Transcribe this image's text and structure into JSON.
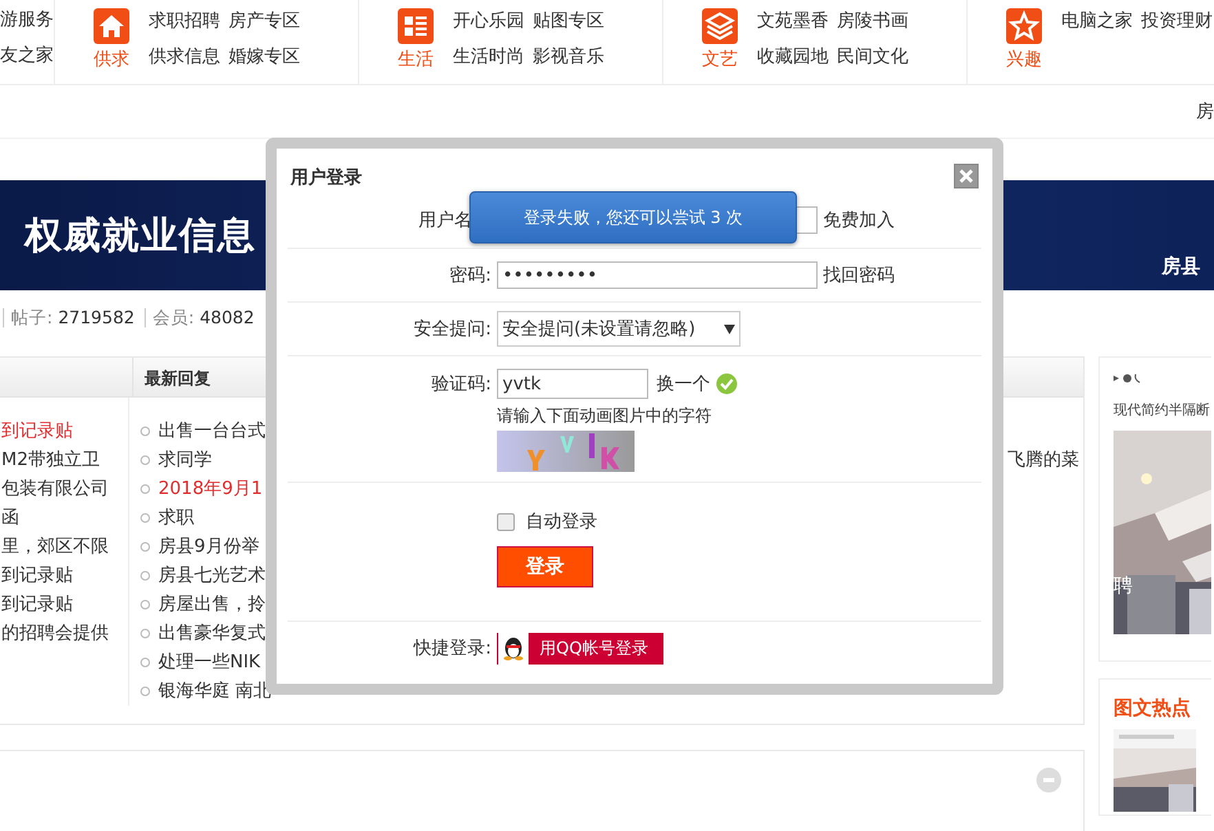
{
  "top_nav": {
    "partial_links": [
      "游服务",
      "友之家"
    ],
    "groups": [
      {
        "kind": "house",
        "label": "供求",
        "links": [
          "求职招聘",
          "房产专区",
          "供求信息",
          "婚嫁专区"
        ]
      },
      {
        "kind": "list",
        "label": "生活",
        "links": [
          "开心乐园",
          "贴图专区",
          "生活时尚",
          "影视音乐"
        ]
      },
      {
        "kind": "layers",
        "label": "文艺",
        "links": [
          "文苑墨香",
          "房陵书画",
          "收藏园地",
          "民间文化"
        ]
      },
      {
        "kind": "star",
        "label": "兴趣",
        "links": [
          "电脑之家",
          "投资理财"
        ]
      }
    ]
  },
  "sub_bar": {
    "text": "房"
  },
  "banner": {
    "headline": "权威就业信息",
    "location": "房县"
  },
  "stats": [
    {
      "label": "帖子:",
      "value": "2719582"
    },
    {
      "label": "会员:",
      "value": "48082"
    }
  ],
  "latest": {
    "heading": "最新回复",
    "column_1": [
      {
        "text": "到记录贴",
        "highlighted": true
      },
      {
        "text": "M2带独立卫",
        "highlighted": false
      },
      {
        "text": "包装有限公司",
        "highlighted": false
      },
      {
        "text": "函",
        "highlighted": false
      },
      {
        "text": "里，郊区不限",
        "highlighted": false
      },
      {
        "text": "到记录贴",
        "highlighted": false
      },
      {
        "text": "到记录贴",
        "highlighted": false
      },
      {
        "text": "的招聘会提供",
        "highlighted": false
      }
    ],
    "column_2": [
      {
        "text": "出售一台台式",
        "highlighted": false
      },
      {
        "text": "求同学",
        "highlighted": false
      },
      {
        "text": "2018年9月1",
        "highlighted": true
      },
      {
        "text": "求职",
        "highlighted": false
      },
      {
        "text": "房县9月份举",
        "highlighted": false
      },
      {
        "text": "房县七光艺术",
        "highlighted": false
      },
      {
        "text": "房屋出售，拎",
        "highlighted": false
      },
      {
        "text": "出售豪华复式",
        "highlighted": false
      },
      {
        "text": "处理一些NIK",
        "highlighted": false
      },
      {
        "text": "银海华庭 南北",
        "highlighted": false
      }
    ],
    "column_4": [
      {
        "text": "飞腾的菜",
        "highlighted": false
      }
    ]
  },
  "sidebar": {
    "caption": "现代简约半隔断",
    "overlay_text": "聘",
    "hot_title": "图文热点"
  },
  "login_dialog": {
    "title": "用户登录",
    "toast": "登录失败，您还可以尝试 3 次",
    "username": {
      "label": "用户名",
      "link": "免费加入"
    },
    "password": {
      "label": "密码:",
      "value": "•••••••••",
      "link": "找回密码"
    },
    "question": {
      "label": "安全提问:",
      "value": "安全提问(未设置请忽略)"
    },
    "captcha": {
      "label": "验证码:",
      "value": "yvtk",
      "refresh": "换一个",
      "hint": "请输入下面动画图片中的字符"
    },
    "remember": {
      "label": "自动登录",
      "checked": false
    },
    "submit": "登录",
    "quick": {
      "label": "快捷登录:",
      "button": "用QQ帐号登录"
    }
  }
}
